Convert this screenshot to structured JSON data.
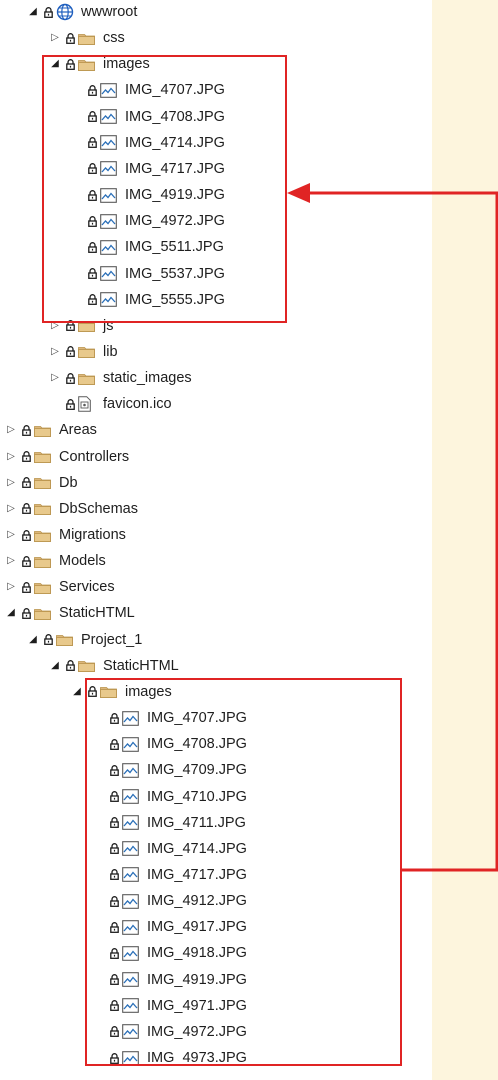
{
  "tree": [
    {
      "label": "wwwroot",
      "depth": 1,
      "expander": "open",
      "icon": "globe-icon",
      "lock": true
    },
    {
      "label": "css",
      "depth": 2,
      "expander": "closed",
      "icon": "folder-icon",
      "lock": true
    },
    {
      "label": "images",
      "depth": 2,
      "expander": "open",
      "icon": "folder-icon",
      "lock": true
    },
    {
      "label": "IMG_4707.JPG",
      "depth": 3,
      "expander": "none",
      "icon": "image-file-icon",
      "lock": true
    },
    {
      "label": "IMG_4708.JPG",
      "depth": 3,
      "expander": "none",
      "icon": "image-file-icon",
      "lock": true
    },
    {
      "label": "IMG_4714.JPG",
      "depth": 3,
      "expander": "none",
      "icon": "image-file-icon",
      "lock": true
    },
    {
      "label": "IMG_4717.JPG",
      "depth": 3,
      "expander": "none",
      "icon": "image-file-icon",
      "lock": true
    },
    {
      "label": "IMG_4919.JPG",
      "depth": 3,
      "expander": "none",
      "icon": "image-file-icon",
      "lock": true
    },
    {
      "label": "IMG_4972.JPG",
      "depth": 3,
      "expander": "none",
      "icon": "image-file-icon",
      "lock": true
    },
    {
      "label": "IMG_5511.JPG",
      "depth": 3,
      "expander": "none",
      "icon": "image-file-icon",
      "lock": true
    },
    {
      "label": "IMG_5537.JPG",
      "depth": 3,
      "expander": "none",
      "icon": "image-file-icon",
      "lock": true
    },
    {
      "label": "IMG_5555.JPG",
      "depth": 3,
      "expander": "none",
      "icon": "image-file-icon",
      "lock": true
    },
    {
      "label": "js",
      "depth": 2,
      "expander": "closed",
      "icon": "folder-icon",
      "lock": true
    },
    {
      "label": "lib",
      "depth": 2,
      "expander": "closed",
      "icon": "folder-icon",
      "lock": true
    },
    {
      "label": "static_images",
      "depth": 2,
      "expander": "closed",
      "icon": "folder-icon",
      "lock": true
    },
    {
      "label": "favicon.ico",
      "depth": 2,
      "expander": "none",
      "icon": "favicon-file-icon",
      "lock": true
    },
    {
      "label": "Areas",
      "depth": 0,
      "expander": "closed",
      "icon": "folder-icon",
      "lock": true
    },
    {
      "label": "Controllers",
      "depth": 0,
      "expander": "closed",
      "icon": "folder-icon",
      "lock": true
    },
    {
      "label": "Db",
      "depth": 0,
      "expander": "closed",
      "icon": "folder-icon",
      "lock": true
    },
    {
      "label": "DbSchemas",
      "depth": 0,
      "expander": "closed",
      "icon": "folder-icon",
      "lock": true
    },
    {
      "label": "Migrations",
      "depth": 0,
      "expander": "closed",
      "icon": "folder-icon",
      "lock": true
    },
    {
      "label": "Models",
      "depth": 0,
      "expander": "closed",
      "icon": "folder-icon",
      "lock": true
    },
    {
      "label": "Services",
      "depth": 0,
      "expander": "closed",
      "icon": "folder-icon",
      "lock": true
    },
    {
      "label": "StaticHTML",
      "depth": 0,
      "expander": "open",
      "icon": "folder-icon",
      "lock": true
    },
    {
      "label": "Project_1",
      "depth": 1,
      "expander": "open",
      "icon": "folder-icon",
      "lock": true
    },
    {
      "label": "StaticHTML",
      "depth": 2,
      "expander": "open",
      "icon": "folder-icon",
      "lock": true
    },
    {
      "label": "images",
      "depth": 3,
      "expander": "open",
      "icon": "folder-icon",
      "lock": true
    },
    {
      "label": "IMG_4707.JPG",
      "depth": 4,
      "expander": "none",
      "icon": "image-file-icon",
      "lock": true
    },
    {
      "label": "IMG_4708.JPG",
      "depth": 4,
      "expander": "none",
      "icon": "image-file-icon",
      "lock": true
    },
    {
      "label": "IMG_4709.JPG",
      "depth": 4,
      "expander": "none",
      "icon": "image-file-icon",
      "lock": true
    },
    {
      "label": "IMG_4710.JPG",
      "depth": 4,
      "expander": "none",
      "icon": "image-file-icon",
      "lock": true
    },
    {
      "label": "IMG_4711.JPG",
      "depth": 4,
      "expander": "none",
      "icon": "image-file-icon",
      "lock": true
    },
    {
      "label": "IMG_4714.JPG",
      "depth": 4,
      "expander": "none",
      "icon": "image-file-icon",
      "lock": true
    },
    {
      "label": "IMG_4717.JPG",
      "depth": 4,
      "expander": "none",
      "icon": "image-file-icon",
      "lock": true
    },
    {
      "label": "IMG_4912.JPG",
      "depth": 4,
      "expander": "none",
      "icon": "image-file-icon",
      "lock": true
    },
    {
      "label": "IMG_4917.JPG",
      "depth": 4,
      "expander": "none",
      "icon": "image-file-icon",
      "lock": true
    },
    {
      "label": "IMG_4918.JPG",
      "depth": 4,
      "expander": "none",
      "icon": "image-file-icon",
      "lock": true
    },
    {
      "label": "IMG_4919.JPG",
      "depth": 4,
      "expander": "none",
      "icon": "image-file-icon",
      "lock": true
    },
    {
      "label": "IMG_4971.JPG",
      "depth": 4,
      "expander": "none",
      "icon": "image-file-icon",
      "lock": true
    },
    {
      "label": "IMG_4972.JPG",
      "depth": 4,
      "expander": "none",
      "icon": "image-file-icon",
      "lock": true
    },
    {
      "label": "IMG_4973.JPG",
      "depth": 4,
      "expander": "none",
      "icon": "image-file-icon",
      "lock": true
    }
  ],
  "colors": {
    "background": "#fdf5dd",
    "panel": "#ffffff",
    "annotation": "#e02424",
    "folder": "#dcb67a",
    "lock": "#1e1e1e",
    "globe": "#1f5fbf",
    "image_icon": "#2a6fb8"
  }
}
